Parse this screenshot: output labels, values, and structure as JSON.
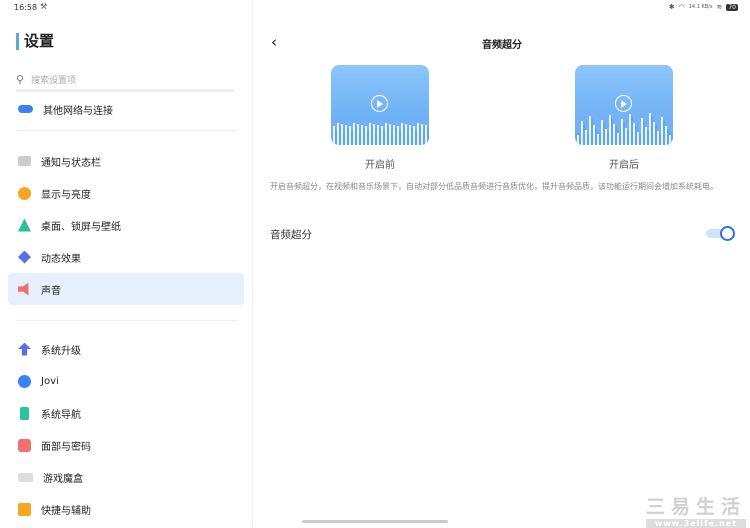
{
  "status_bar": {
    "time": "16:58",
    "tool_icon": "tools-icon",
    "network_speed": "14.1 KB/s",
    "battery": "70"
  },
  "sidebar": {
    "title": "设置",
    "search_placeholder": "搜索设置项",
    "items": [
      {
        "label": "其他网络与连接",
        "icon": "network-icon",
        "color": "#3b82f6"
      },
      {
        "label": "通知与状态栏",
        "icon": "notification-icon",
        "color": "#cccccc"
      },
      {
        "label": "显示与亮度",
        "icon": "brightness-icon",
        "color": "#f5a623"
      },
      {
        "label": "桌面、锁屏与壁纸",
        "icon": "wallpaper-icon",
        "color": "#2bbf9a"
      },
      {
        "label": "动态效果",
        "icon": "animation-icon",
        "color": "#5b6ee8"
      },
      {
        "label": "声音",
        "icon": "sound-icon",
        "color": "#f07070",
        "selected": true
      },
      {
        "label": "系统升级",
        "icon": "upgrade-icon",
        "color": "#5b6ee8"
      },
      {
        "label": "Jovi",
        "icon": "jovi-icon",
        "color": "#3b82f6"
      },
      {
        "label": "系统导航",
        "icon": "navigation-icon",
        "color": "#2bc4a0"
      },
      {
        "label": "面部与密码",
        "icon": "face-icon",
        "color": "#f07070"
      },
      {
        "label": "游戏魔盒",
        "icon": "game-icon",
        "color": "#dddddd"
      },
      {
        "label": "快捷与辅助",
        "icon": "shortcut-icon",
        "color": "#f5a623"
      }
    ]
  },
  "main": {
    "title": "音频超分",
    "before_label": "开启前",
    "after_label": "开启后",
    "description": "开启音频超分，在视频和音乐场景下，自动对部分低品质音频进行音质优化，提升音频品质，该功能运行期间会增加系统耗电。",
    "toggle_label": "音频超分",
    "toggle_on": true,
    "accent": "#2b74e0"
  },
  "watermark": {
    "line1": "三易生活",
    "line2": "www.3elife.net"
  }
}
